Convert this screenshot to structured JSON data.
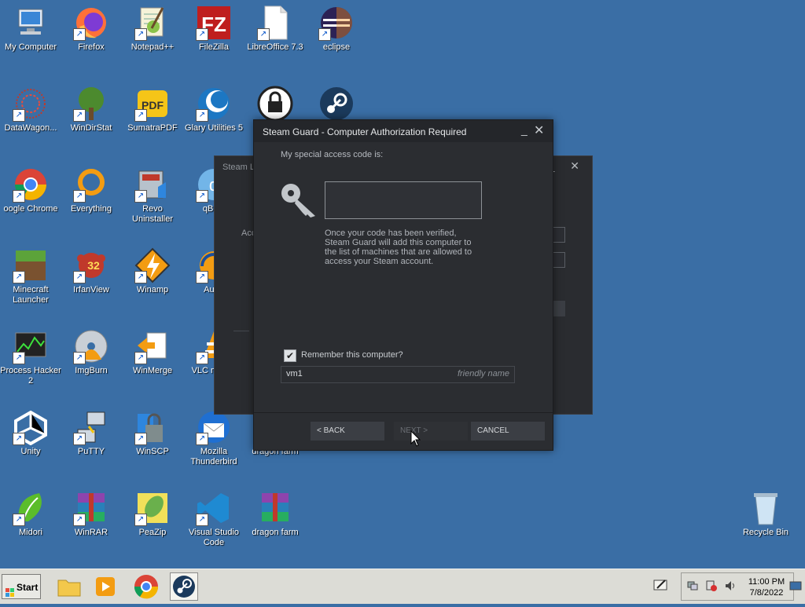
{
  "desktop": {
    "icons": [
      {
        "id": "my-computer",
        "label": "My Computer",
        "icon": "computer-icon"
      },
      {
        "id": "firefox",
        "label": "Firefox",
        "icon": "firefox-icon"
      },
      {
        "id": "notepad",
        "label": "Notepad++",
        "icon": "notepad-plus-icon"
      },
      {
        "id": "filezilla",
        "label": "FileZilla",
        "icon": "filezilla-icon"
      },
      {
        "id": "libreoffice",
        "label": "LibreOffice 7.3",
        "icon": "libreoffice-icon"
      },
      {
        "id": "eclipse",
        "label": "eclipse",
        "icon": "eclipse-icon"
      },
      {
        "id": "datawagon",
        "label": "DataWagon...",
        "icon": "datawagon-icon"
      },
      {
        "id": "windirstat",
        "label": "WinDirStat",
        "icon": "windirstat-icon"
      },
      {
        "id": "sumatra",
        "label": "SumatraPDF",
        "icon": "sumatra-pdf-icon"
      },
      {
        "id": "glary",
        "label": "Glary Utilities 5",
        "icon": "glary-icon"
      },
      {
        "id": "lock",
        "label": "",
        "icon": "lock-icon"
      },
      {
        "id": "steam-desktop",
        "label": "",
        "icon": "steam-icon"
      },
      {
        "id": "chrome",
        "label": "oogle Chrome",
        "icon": "chrome-icon"
      },
      {
        "id": "everything",
        "label": "Everything",
        "icon": "everything-icon"
      },
      {
        "id": "revo",
        "label": "Revo Uninstaller",
        "icon": "revo-icon"
      },
      {
        "id": "qbittorrent",
        "label": "qBitto",
        "icon": "qbittorrent-icon"
      },
      {
        "id": "minecraft",
        "label": "Minecraft Launcher",
        "icon": "minecraft-icon"
      },
      {
        "id": "irfanview",
        "label": "IrfanView",
        "icon": "irfanview-icon"
      },
      {
        "id": "winamp",
        "label": "Winamp",
        "icon": "winamp-icon"
      },
      {
        "id": "audacity",
        "label": "Auda",
        "icon": "audacity-icon"
      },
      {
        "id": "processhacker",
        "label": "Process Hacker 2",
        "icon": "process-hacker-icon"
      },
      {
        "id": "imgburn",
        "label": "ImgBurn",
        "icon": "imgburn-icon"
      },
      {
        "id": "winmerge",
        "label": "WinMerge",
        "icon": "winmerge-icon"
      },
      {
        "id": "vlc",
        "label": "VLC m play",
        "icon": "vlc-icon"
      },
      {
        "id": "unity",
        "label": "Unity",
        "icon": "unity-icon"
      },
      {
        "id": "putty",
        "label": "PuTTY",
        "icon": "putty-icon"
      },
      {
        "id": "winscp",
        "label": "WinSCP",
        "icon": "winscp-icon"
      },
      {
        "id": "thunderbird",
        "label": "Mozilla Thunderbird",
        "icon": "thunderbird-icon"
      },
      {
        "id": "dragonfarm1",
        "label": "dragon farm",
        "icon": "folder-icon"
      },
      {
        "id": "midori",
        "label": "Midori",
        "icon": "midori-icon"
      },
      {
        "id": "winrar",
        "label": "WinRAR",
        "icon": "winrar-icon"
      },
      {
        "id": "peazip",
        "label": "PeaZip",
        "icon": "peazip-icon"
      },
      {
        "id": "vscode",
        "label": "Visual Studio Code",
        "icon": "vscode-icon"
      },
      {
        "id": "dragonfarm2",
        "label": "dragon farm",
        "icon": "winrar-archive-icon"
      },
      {
        "id": "recycle",
        "label": "Recycle Bin",
        "icon": "recycle-bin-icon"
      }
    ]
  },
  "background_window": {
    "title": "Steam L",
    "label_fragment": "Acc"
  },
  "dialog": {
    "title": "Steam Guard - Computer Authorization Required",
    "prompt": "My special access code is:",
    "code_value": "",
    "info": "Once your code has been verified, Steam Guard will add this computer to the list of machines that are allowed to access your Steam account.",
    "remember_label": "Remember this computer?",
    "remember_checked": true,
    "friendly_name_value": "vm1",
    "friendly_name_hint": "friendly name",
    "buttons": {
      "back": "< BACK",
      "next": "NEXT >",
      "cancel": "CANCEL"
    },
    "minimize_glyph": "_",
    "close_glyph": "✕"
  },
  "taskbar": {
    "start_label": "Start",
    "items": [
      {
        "name": "explorer",
        "icon": "folder-icon"
      },
      {
        "name": "media",
        "icon": "media-player-icon"
      },
      {
        "name": "chrome",
        "icon": "chrome-icon"
      },
      {
        "name": "steam",
        "icon": "steam-icon",
        "active": true
      }
    ],
    "time": "11:00 PM",
    "date": "7/8/2022"
  },
  "colors": {
    "desktop_bg": "#3a6ea5",
    "dialog_bg": "#2b2d31",
    "dialog_title_bg": "#24262a",
    "button_bg": "#3b3e44"
  }
}
